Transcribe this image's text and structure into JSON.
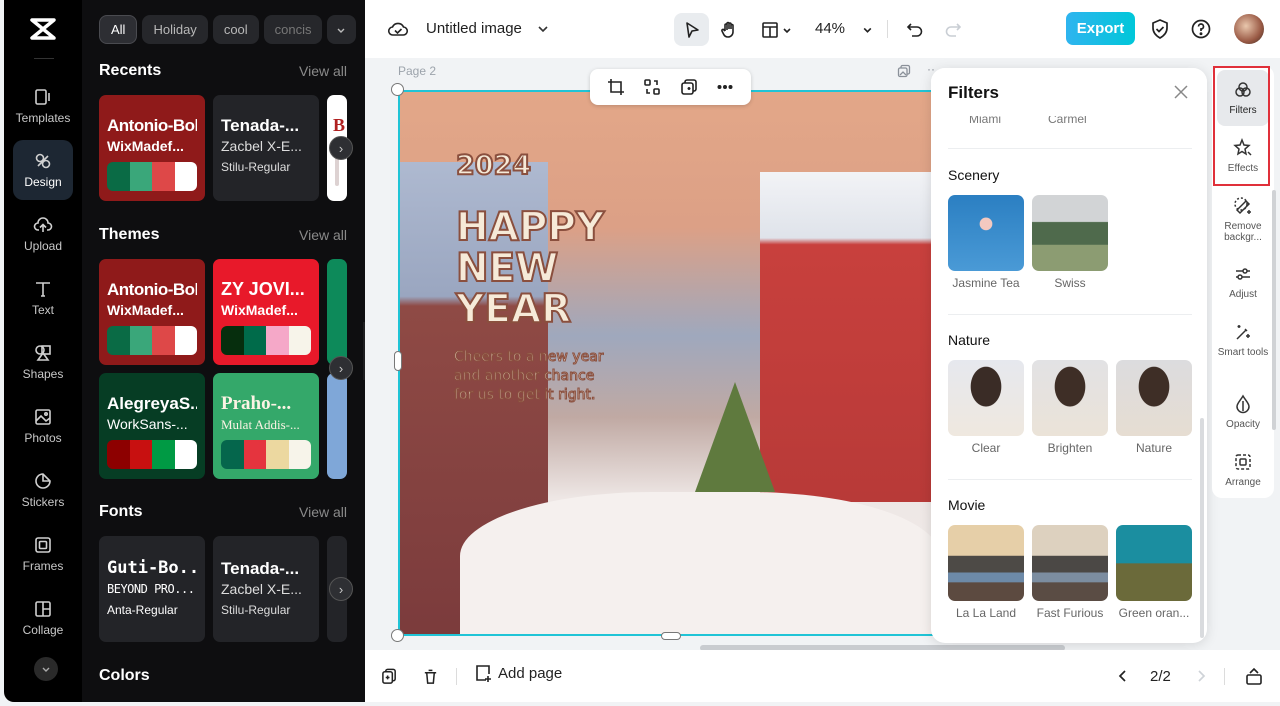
{
  "left_rail": {
    "logo": "capcut-logo",
    "items": [
      {
        "label": "Templates",
        "icon": "templates-icon"
      },
      {
        "label": "Design",
        "icon": "design-icon",
        "active": true
      },
      {
        "label": "Upload",
        "icon": "upload-icon"
      },
      {
        "label": "Text",
        "icon": "text-icon"
      },
      {
        "label": "Shapes",
        "icon": "shapes-icon"
      },
      {
        "label": "Photos",
        "icon": "photos-icon"
      },
      {
        "label": "Stickers",
        "icon": "stickers-icon"
      },
      {
        "label": "Frames",
        "icon": "frames-icon"
      },
      {
        "label": "Collage",
        "icon": "collage-icon"
      }
    ]
  },
  "design_panel": {
    "chips": [
      "All",
      "Holiday",
      "cool",
      "concis"
    ],
    "sections": {
      "recents": {
        "title": "Recents",
        "view_all": "View all"
      },
      "themes": {
        "title": "Themes",
        "view_all": "View all"
      },
      "fonts": {
        "title": "Fonts",
        "view_all": "View all"
      },
      "colors": {
        "title": "Colors"
      }
    },
    "recents_cards": [
      {
        "title": "Antonio-Bold",
        "subtitle": "WixMadef...",
        "bg": "#8f1a1a",
        "swatches": [
          "#0a6b45",
          "#3aa77a",
          "#de4848",
          "#ffffff"
        ]
      },
      {
        "title": "Tenada-...",
        "subtitle": "Zacbel X-E...",
        "caption": "Stilu-Regular",
        "bg": "#232428"
      }
    ],
    "theme_cards": [
      {
        "title": "Antonio-Bold",
        "subtitle": "WixMadef...",
        "bg": "#8f1a1a",
        "swatches": [
          "#0a6b45",
          "#3aa77a",
          "#de4848",
          "#ffffff"
        ]
      },
      {
        "title": "ZY JOVI...",
        "subtitle": "WixMadef...",
        "bg": "#e8192a",
        "swatches": [
          "#062e0d",
          "#006b4a",
          "#f5a8c8",
          "#f7f4ea"
        ]
      },
      {
        "title": "AlegreyaS...",
        "subtitle": "WorkSans-...",
        "bg": "#063d24",
        "swatches": [
          "#8d0000",
          "#c81010",
          "#009a44",
          "#ffffff"
        ]
      },
      {
        "title": "Praho-...",
        "subtitle": "Mulat Addis-...",
        "bg": "#34a86a",
        "swatches": [
          "#05664c",
          "#e5343e",
          "#ecd8a0",
          "#f7f4ea"
        ]
      }
    ],
    "font_cards": [
      {
        "title": "Guti-Bo...",
        "subtitle": "BEYOND PRO...",
        "caption": "Anta-Regular"
      },
      {
        "title": "Tenada-...",
        "subtitle": "Zacbel X-E...",
        "caption": "Stilu-Regular"
      }
    ]
  },
  "topbar": {
    "doc_title": "Untitled image",
    "zoom": "44%",
    "export_label": "Export"
  },
  "canvas": {
    "page_label": "Page 2",
    "artwork": {
      "year": "2024",
      "headline": [
        "HAPPY",
        "NEW",
        "YEAR"
      ],
      "message": [
        "Cheers to a new year",
        "and another chance",
        "for us to get it right."
      ]
    }
  },
  "filters_panel": {
    "title": "Filters",
    "cut_labels": [
      "Miami",
      "Carmel"
    ],
    "categories": [
      {
        "name": "Scenery",
        "items": [
          "Jasmine Tea",
          "Swiss"
        ]
      },
      {
        "name": "Nature",
        "items": [
          "Clear",
          "Brighten",
          "Nature"
        ]
      },
      {
        "name": "Movie",
        "items": [
          "La La Land",
          "Fast Furious",
          "Green oran..."
        ]
      }
    ]
  },
  "right_rail": {
    "items": [
      {
        "label": "Filters",
        "icon": "filters-icon",
        "active": true
      },
      {
        "label": "Effects",
        "icon": "effects-icon"
      },
      {
        "label": "Remove backgr...",
        "icon": "remove-background-icon"
      },
      {
        "label": "Adjust",
        "icon": "adjust-icon"
      },
      {
        "label": "Smart tools",
        "icon": "smart-tools-icon"
      },
      {
        "label": "Opacity",
        "icon": "opacity-icon"
      },
      {
        "label": "Arrange",
        "icon": "arrange-icon"
      }
    ]
  },
  "bottombar": {
    "add_page": "Add page",
    "page_counter": "2/2"
  }
}
